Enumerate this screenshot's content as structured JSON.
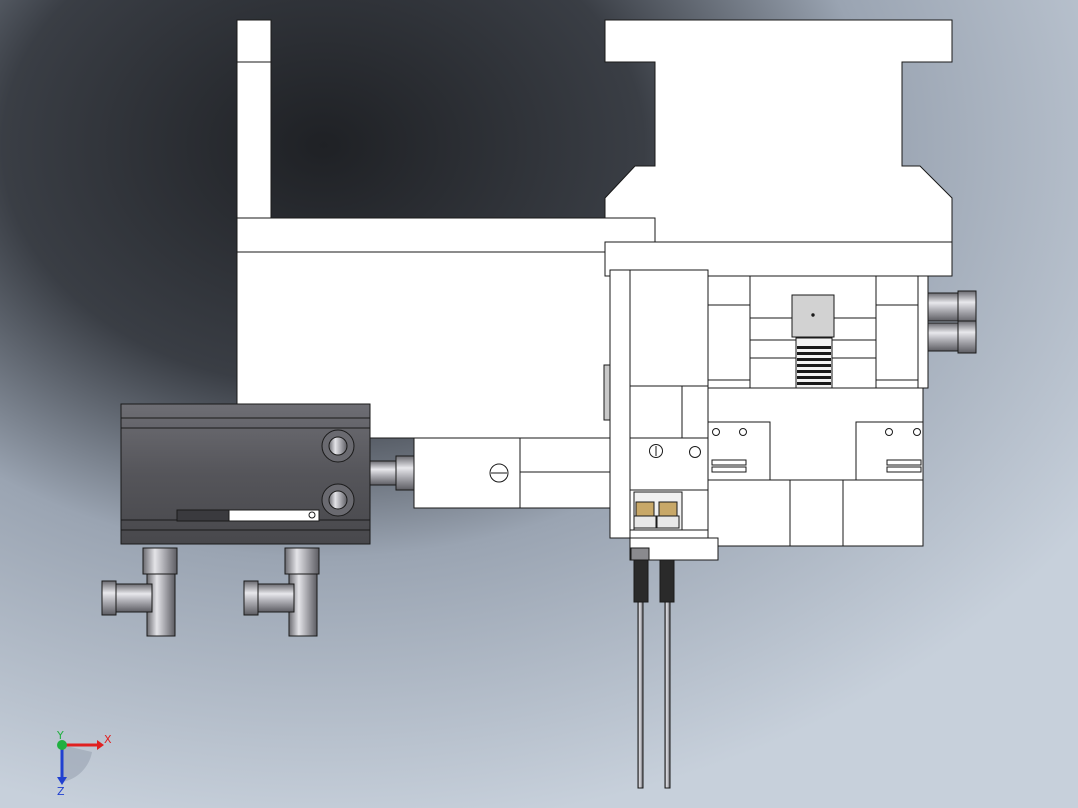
{
  "viewport": {
    "background_top": "#2a2d33",
    "background_bottom": "#c3ccd8"
  },
  "triad": {
    "x_label": "X",
    "y_label": "Y",
    "z_label": "Z",
    "x_color": "#e02020",
    "y_color": "#20b040",
    "z_color": "#2040d0"
  },
  "colors": {
    "part_face": "#ffffff",
    "edge": "#1a1a1a",
    "cylinder_body": "#58585c",
    "fitting_metal": "#a8a8ae",
    "brass": "#c8a868"
  }
}
